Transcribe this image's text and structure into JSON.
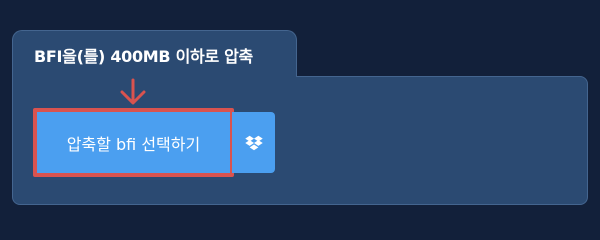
{
  "panel": {
    "title": "BFI을(를) 400MB 이하로 압축"
  },
  "upload": {
    "select_label": "압축할 bfi 선택하기",
    "dropbox_icon": "dropbox-icon",
    "arrow_icon": "arrow-down-icon"
  },
  "colors": {
    "page_background": "#12203a",
    "panel_background": "#2b4a72",
    "button": "#4b9ff0",
    "highlight": "#d9534f"
  }
}
